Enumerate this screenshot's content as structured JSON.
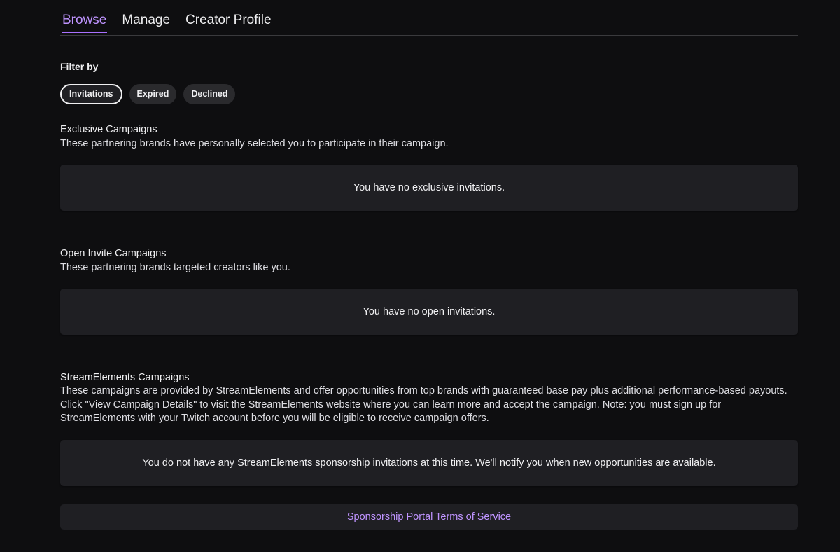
{
  "tabs": [
    {
      "label": "Browse",
      "active": true
    },
    {
      "label": "Manage",
      "active": false
    },
    {
      "label": "Creator Profile",
      "active": false
    }
  ],
  "filter": {
    "label": "Filter by",
    "options": [
      {
        "label": "Invitations",
        "selected": true
      },
      {
        "label": "Expired",
        "selected": false
      },
      {
        "label": "Declined",
        "selected": false
      }
    ]
  },
  "sections": {
    "exclusive": {
      "title": "Exclusive Campaigns",
      "description": "These partnering brands have personally selected you to participate in their campaign.",
      "empty_message": "You have no exclusive invitations."
    },
    "open_invite": {
      "title": "Open Invite Campaigns",
      "description": "These partnering brands targeted creators like you.",
      "empty_message": "You have no open invitations."
    },
    "streamelements": {
      "title": "StreamElements Campaigns",
      "description": "These campaigns are provided by StreamElements and offer opportunities from top brands with guaranteed base pay plus additional performance-based payouts. Click \"View Campaign Details\" to visit the StreamElements website where you can learn more and accept the campaign. Note: you must sign up for StreamElements with your Twitch account before you will be eligible to receive campaign offers.",
      "empty_message": "You do not have any StreamElements sponsorship invitations at this time. We'll notify you when new opportunities are available."
    }
  },
  "footer": {
    "tos_link": "Sponsorship Portal Terms of Service"
  },
  "colors": {
    "background": "#0e0e10",
    "panel": "#1f1f23",
    "accent": "#bf94ff",
    "text": "#efeff1"
  }
}
